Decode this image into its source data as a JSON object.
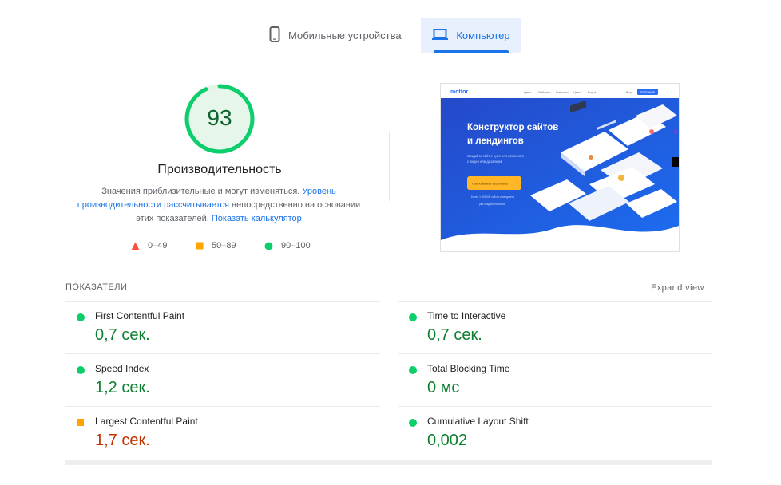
{
  "tabs": {
    "mobile": {
      "label": "Мобильные устройства",
      "icon": "smartphone-icon"
    },
    "desktop": {
      "label": "Компьютер",
      "icon": "laptop-icon",
      "active": true
    }
  },
  "score": {
    "value": "93",
    "fraction": 0.93,
    "title": "Производительность",
    "color": "#0cce6b"
  },
  "description": {
    "text1": "Значения приблизительные и могут изменяться. ",
    "link1": "Уровень производительности рассчитывается",
    "text2": " непосредственно на основании этих показателей. ",
    "link2": "Показать калькулятор"
  },
  "legend": [
    {
      "shape": "triangle-icon",
      "range": "0–49",
      "color": "#ff4e42"
    },
    {
      "shape": "square-icon",
      "range": "50–89",
      "color": "#ffa400"
    },
    {
      "shape": "circle-icon",
      "range": "90–100",
      "color": "#0cce6b"
    }
  ],
  "screenshot": {
    "logo": "mottor",
    "nav": [
      "Цены",
      "Шаблоны",
      "Шаблоны",
      "Цены",
      "Ещё ▾"
    ],
    "login": "Вход",
    "cta_top": "Регистрация",
    "headline_1": "Конструктор сайтов",
    "headline_2": "и лендингов",
    "subtext_1": "Создайте сайт с нуля или используя",
    "subtext_2": "с видео или дизайном",
    "button": "Попробовать бесплатно",
    "small_1": "Более 1 000 000 сайтов и лендингов",
    "small_2": "уже создано на mottor"
  },
  "metrics": {
    "section_label": "ПОКАЗАТЕЛИ",
    "expand_label": "Expand view",
    "items": [
      {
        "name": "First Contentful Paint",
        "value": "0,7 сек.",
        "status": "good"
      },
      {
        "name": "Time to Interactive",
        "value": "0,7 сек.",
        "status": "good"
      },
      {
        "name": "Speed Index",
        "value": "1,2 сек.",
        "status": "good"
      },
      {
        "name": "Total Blocking Time",
        "value": "0 мс",
        "status": "good"
      },
      {
        "name": "Largest Contentful Paint",
        "value": "1,7 сек.",
        "status": "average"
      },
      {
        "name": "Cumulative Layout Shift",
        "value": "0,002",
        "status": "good"
      }
    ]
  },
  "colors": {
    "good": "#0cce6b",
    "good_text": "#0d7f2f",
    "average": "#ffa400",
    "average_text": "#c33300",
    "accent": "#1a73e8"
  }
}
